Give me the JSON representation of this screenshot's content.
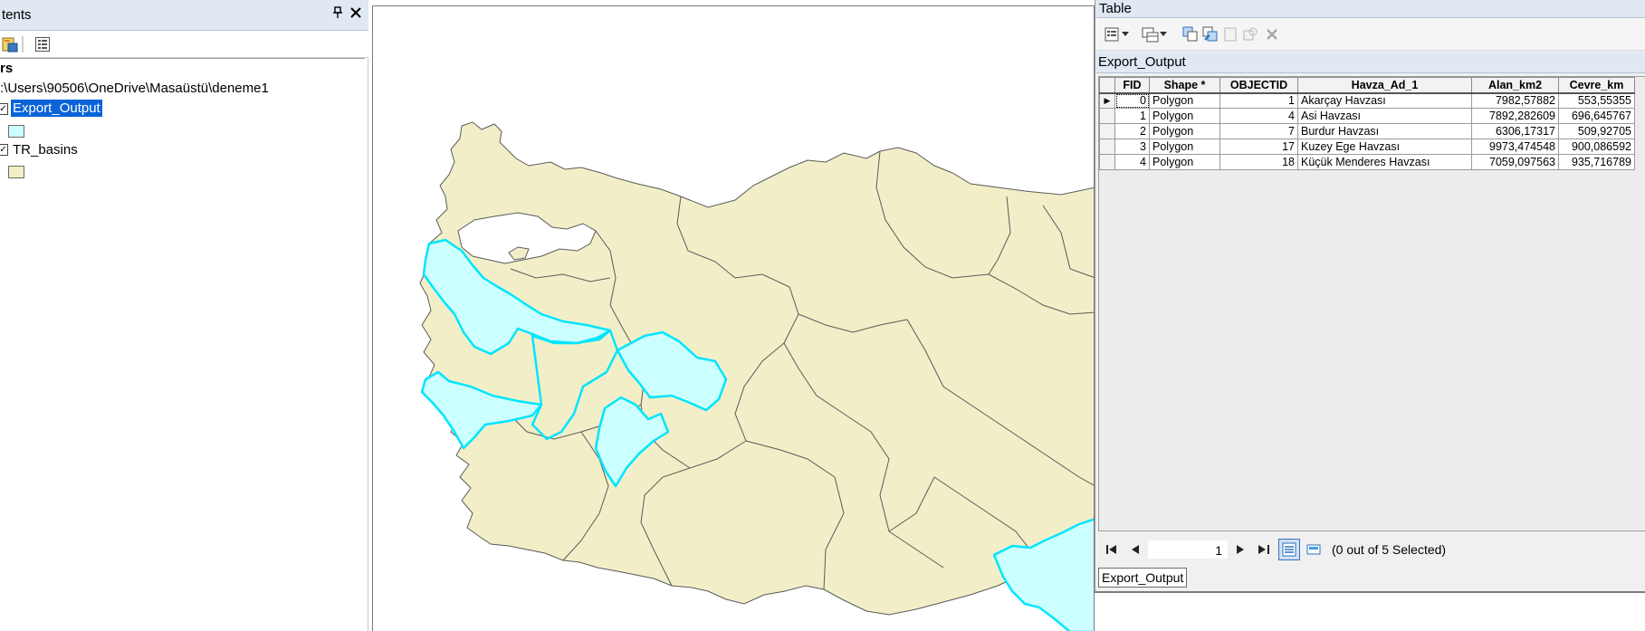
{
  "toc": {
    "title": "tents",
    "pin_glyph": "○",
    "close_glyph": "✕",
    "heading": "rs",
    "path": ":\\Users\\90506\\OneDrive\\Masaüstü\\deneme1",
    "layers": [
      {
        "name": "Export_Output",
        "checked": true,
        "selected": true,
        "swatch_color": "#ccffff"
      },
      {
        "name": "TR_basins",
        "checked": true,
        "selected": false,
        "swatch_color": "#f2efc8"
      }
    ]
  },
  "map": {
    "basin_fill": "#f2efc8",
    "basin_outline": "#5a5a5a",
    "selected_fill": "#ccffff",
    "selected_outline": "#00e5ff"
  },
  "table_window": {
    "title": "Table",
    "table_name": "Export_Output",
    "columns": [
      "FID",
      "Shape *",
      "OBJECTID",
      "Havza_Ad_1",
      "Alan_km2",
      "Cevre_km"
    ],
    "rows": [
      [
        "0",
        "Polygon",
        "1",
        "Akarçay Havzası",
        "7982,57882",
        "553,55355"
      ],
      [
        "1",
        "Polygon",
        "4",
        "Asi Havzası",
        "7892,282609",
        "696,645767"
      ],
      [
        "2",
        "Polygon",
        "7",
        "Burdur Havzası",
        "6306,17317",
        "509,92705"
      ],
      [
        "3",
        "Polygon",
        "17",
        "Kuzey Ege Havzası",
        "9973,474548",
        "900,086592"
      ],
      [
        "4",
        "Polygon",
        "18",
        "Küçük Menderes Havzası",
        "7059,097563",
        "935,716789"
      ]
    ],
    "nav": {
      "first": "⏮",
      "prev": "◀",
      "record": "1",
      "next": "▶",
      "last": "⏭",
      "status": "(0 out of 5 Selected)"
    },
    "bottom_tab": "Export_Output"
  }
}
